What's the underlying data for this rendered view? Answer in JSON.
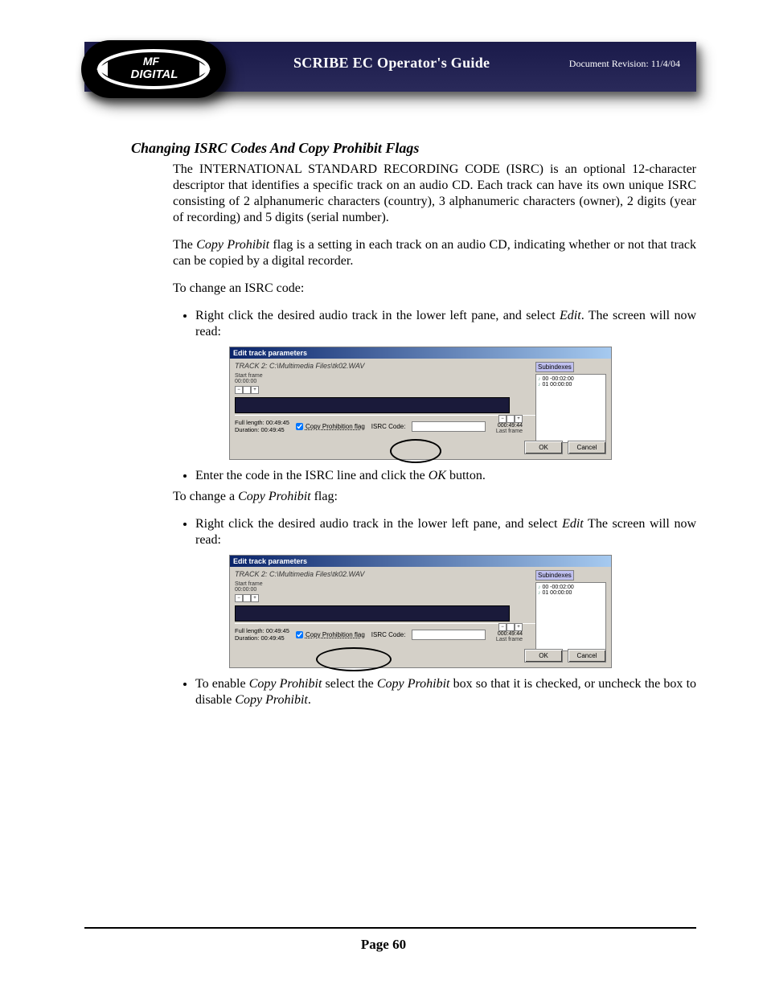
{
  "header": {
    "logo_text_top": "MF",
    "logo_text_bottom": "DIGITAL",
    "title": "SCRIBE EC Operator's Guide",
    "revision": "Document Revision: 11/4/04"
  },
  "section": {
    "title": "Changing ISRC Codes And Copy Prohibit Flags",
    "para1_a": "The INTERNATIONAL STANDARD RECORDING CODE (ISRC) is an optional 12-character descriptor that identifies a specific track on an audio CD. Each track can have its own unique ISRC consisting of 2 alphanumeric characters (country), 3 alphanumeric characters (owner), 2 digits (year of recording) and 5 digits (serial number).",
    "para2_a": "The ",
    "para2_i": "Copy Prohibit",
    "para2_b": " flag is a setting in each track on an audio CD, indicating whether or not that track can be copied by a digital recorder.",
    "para3": "To change an ISRC code:",
    "bullet1_a": "Right click the desired audio track in the lower left pane, and select ",
    "bullet1_i": "Edit",
    "bullet1_b": ". The screen will now read:",
    "bullet2_a": "Enter the code in the ISRC line and click the ",
    "bullet2_i": "OK",
    "bullet2_b": " button.",
    "para4_a": "To change a ",
    "para4_i": "Copy Prohibit",
    "para4_b": " flag:",
    "bullet3_a": "Right click the desired audio track in the lower left pane, and select ",
    "bullet3_i": "Edit",
    "bullet3_b": " The screen will now read:",
    "bullet4_a": "To enable ",
    "bullet4_i1": "Copy Prohibit",
    "bullet4_b": " select the ",
    "bullet4_i2": "Copy Prohibit",
    "bullet4_c": " box so that it is checked, or uncheck the box to disable ",
    "bullet4_i3": "Copy Prohibit",
    "bullet4_d": "."
  },
  "dialog": {
    "title": "Edit track parameters",
    "track_line": "TRACK 2: C:\\Multimedia Files\\tk02.WAV",
    "start_frame_label": "Start frame",
    "start_frame_value": "00:00:00",
    "end_value": "000:49:44",
    "last_frame_label": "Last frame",
    "full_length_label": "Full length: 00:49:45",
    "duration_label": "Duration: 00:49:45",
    "copy_prohibit_label": "Copy Prohibition flag",
    "isrc_label_1": "ISRC Code:",
    "isrc_label_2": "ISRC Code:",
    "subindexes_label": "Subindexes",
    "sub_items": [
      "00  -00:02:00",
      "01  00:00:00"
    ],
    "ok_label": "OK",
    "cancel_label": "Cancel"
  },
  "footer": {
    "page_label": "Page 60"
  }
}
